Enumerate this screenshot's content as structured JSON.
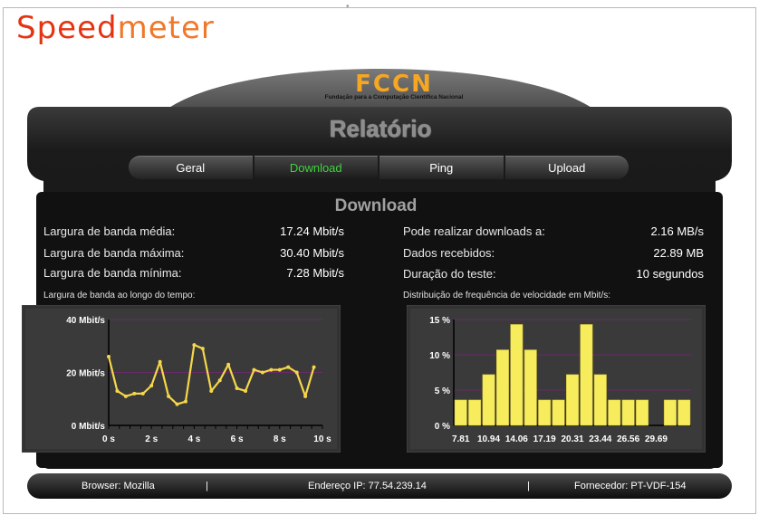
{
  "header": {
    "logo_part1": "Speed",
    "logo_part2": "meter",
    "brand": "FCCN",
    "brand_subtitle": "Fundação para a Computação Científica Nacional"
  },
  "report": {
    "title": "Relatório",
    "tabs": [
      {
        "label": "Geral",
        "active": false
      },
      {
        "label": "Download",
        "active": true
      },
      {
        "label": "Ping",
        "active": false
      },
      {
        "label": "Upload",
        "active": false
      }
    ],
    "section_title": "Download"
  },
  "stats_left": [
    {
      "label": "Largura de banda média:",
      "value": "17.24 Mbit/s"
    },
    {
      "label": "Largura de banda máxima:",
      "value": "30.40 Mbit/s"
    },
    {
      "label": "Largura de banda mínima:",
      "value": "7.28 Mbit/s"
    }
  ],
  "stats_right": [
    {
      "label": "Pode realizar downloads a:",
      "value": "2.16 MB/s"
    },
    {
      "label": "Dados recebidos:",
      "value": "22.89 MB"
    },
    {
      "label": "Duração do teste:",
      "value": "10 segundos"
    }
  ],
  "chart_labels": {
    "left": "Largura de banda ao longo do tempo:",
    "right": "Distribuição de frequência de velocidade em  Mbit/s:"
  },
  "chart_data": [
    {
      "type": "line",
      "title": "",
      "xlabel": "",
      "ylabel": "",
      "yticks": [
        "0 Mbit/s",
        "20 Mbit/s",
        "40 Mbit/s"
      ],
      "xticks": [
        "0 s",
        "2 s",
        "4 s",
        "6 s",
        "8 s",
        "10 s"
      ],
      "xlim": [
        0,
        10
      ],
      "ylim": [
        0,
        40
      ],
      "grid": true,
      "line_color": "#f6d74a",
      "x": [
        0,
        0.4,
        0.8,
        1.2,
        1.6,
        2.0,
        2.4,
        2.8,
        3.2,
        3.6,
        4.0,
        4.4,
        4.8,
        5.2,
        5.6,
        6.0,
        6.4,
        6.8,
        7.2,
        7.6,
        8.0,
        8.4,
        8.8,
        9.2,
        9.6
      ],
      "y": [
        26,
        13,
        11,
        12,
        12,
        15,
        24,
        11,
        8,
        9,
        30.4,
        29,
        13,
        17,
        23,
        14,
        13,
        21,
        20,
        21,
        21,
        22,
        20,
        11,
        22
      ]
    },
    {
      "type": "bar",
      "title": "",
      "xlabel": "",
      "ylabel": "",
      "yticks": [
        "0 %",
        "5 %",
        "10 %",
        "15 %"
      ],
      "xtick_labels": [
        "7.81",
        "10.94",
        "14.06",
        "17.19",
        "20.31",
        "23.44",
        "26.56",
        "29.69"
      ],
      "ylim": [
        0,
        15
      ],
      "grid": true,
      "bar_color": "#f7ec5c",
      "values": [
        3.6,
        3.6,
        7.2,
        10.7,
        14.3,
        10.7,
        3.6,
        3.6,
        7.2,
        14.3,
        7.2,
        3.6,
        3.6,
        3.6,
        0,
        3.6,
        3.6
      ]
    }
  ],
  "footer": {
    "browser": "Browser: Mozilla",
    "ip": "Endereço IP: 77.54.239.14",
    "provider": "Fornecedor: PT-VDF-154",
    "separator": "|"
  }
}
